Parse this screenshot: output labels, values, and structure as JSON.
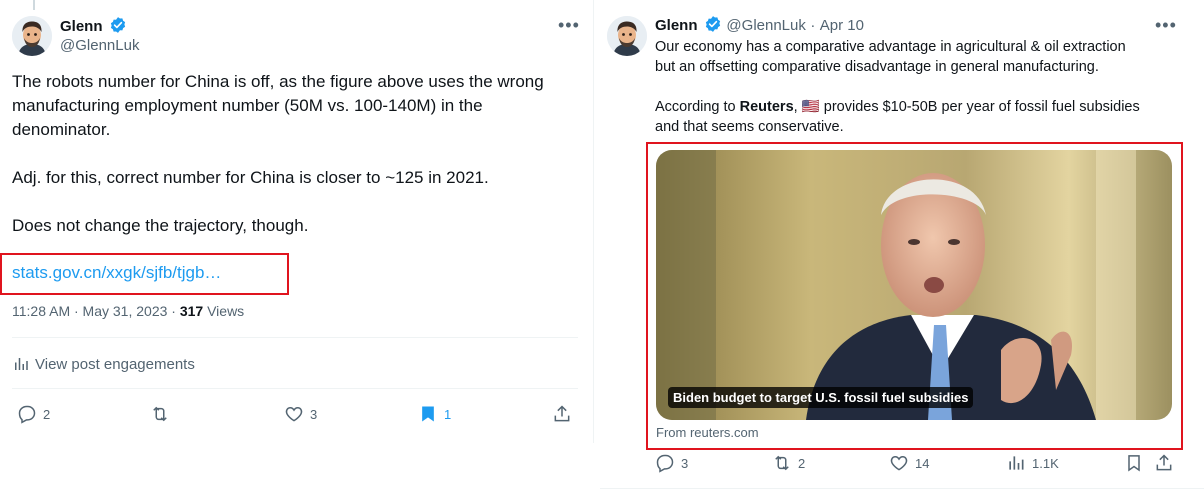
{
  "left_tweet": {
    "author": {
      "name": "Glenn",
      "handle": "@GlennLuk"
    },
    "paragraphs": [
      "The robots number for China is off, as the figure above uses the wrong",
      "manufacturing employment number (50M vs. 100-140M) in the",
      "denominator.",
      "Adj. for this, correct number for China is closer to ~125 in 2021.",
      "Does not change the trajectory, though."
    ],
    "link": "stats.gov.cn/xxgk/sjfb/tjgb…",
    "timestamp": "11:28 AM · May 31, 2023 · ",
    "views_count": "317",
    "views_label": " Views",
    "engagements_label": "View post engagements",
    "replies": "2",
    "reposts": "",
    "likes": "3",
    "bookmarks": "1"
  },
  "right_tweet": {
    "author": {
      "name": "Glenn",
      "handle": "@GlennLuk",
      "date": "Apr 10",
      "sep": "·"
    },
    "text_line1": "Our economy has a comparative advantage in agricultural & oil extraction",
    "text_line2": "but an offsetting comparative disadvantage in general manufacturing.",
    "according_prefix": "According to ",
    "according_source": "Reuters",
    "according_suffix": ", 🇺🇸 provides $10-50B per year of fossil fuel subsidies",
    "text_line4": "and that seems conservative.",
    "card": {
      "caption": "Biden budget to target U.S. fossil fuel subsidies",
      "from": "From reuters.com"
    },
    "replies": "3",
    "reposts": "2",
    "likes": "14",
    "views": "1.1K"
  },
  "colors": {
    "accent": "#1d9bf0",
    "highlight": "#e0141e",
    "muted": "#536471",
    "text": "#0f1419"
  }
}
